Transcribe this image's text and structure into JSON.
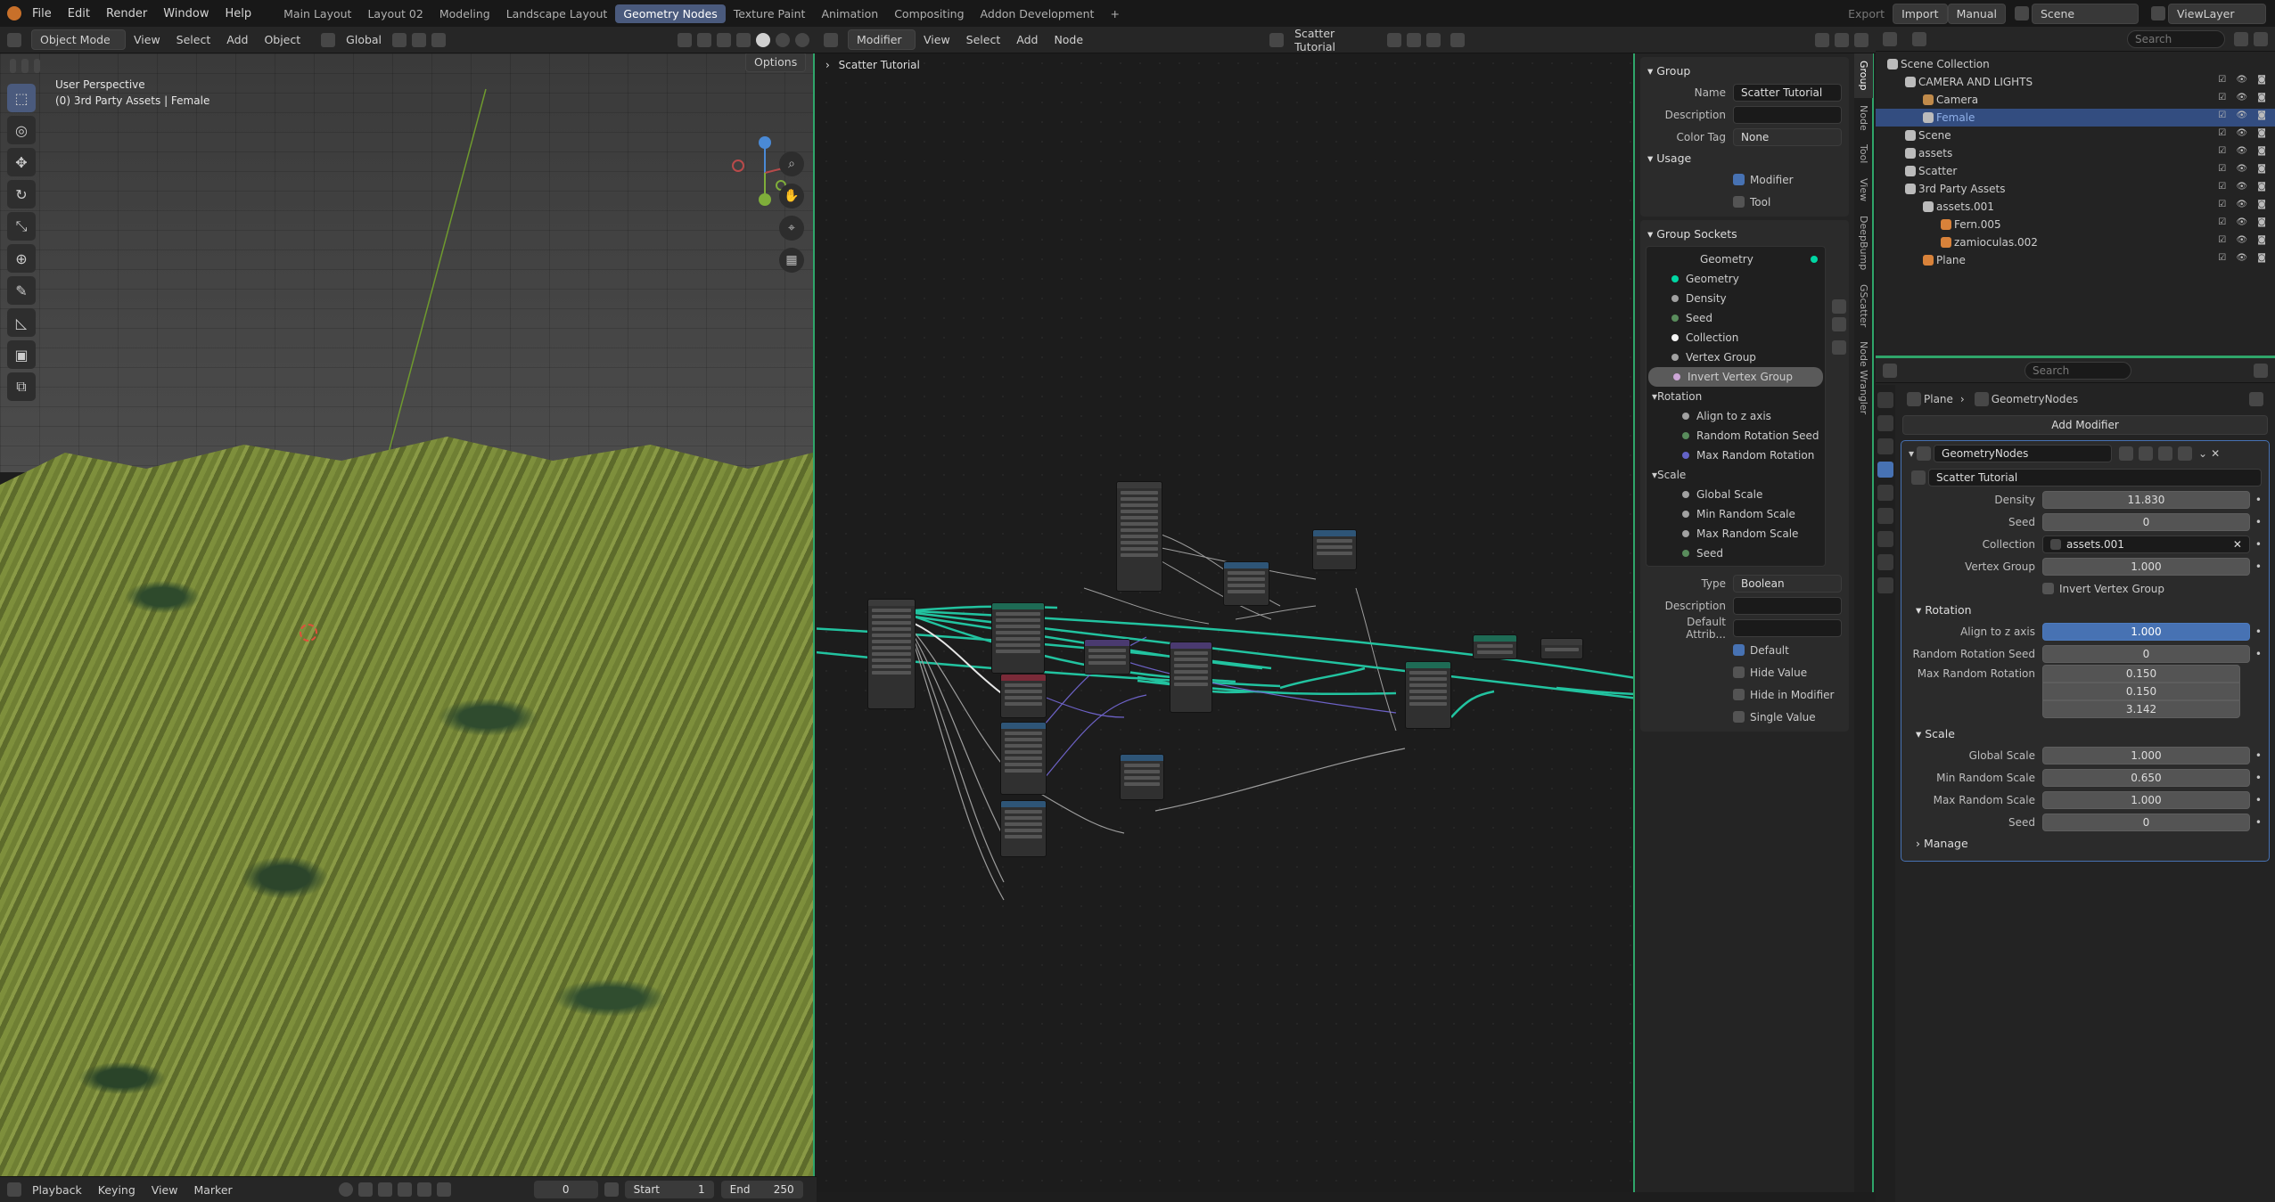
{
  "menubar": {
    "items": [
      "File",
      "Edit",
      "Render",
      "Window",
      "Help"
    ],
    "workspaces": [
      "Main Layout",
      "Layout 02",
      "Modeling",
      "Landscape Layout",
      "Geometry Nodes",
      "Texture Paint",
      "Animation",
      "Compositing",
      "Addon Development"
    ],
    "active_workspace": "Geometry Nodes",
    "add_tab": "+",
    "export_label": "Export",
    "import_label": "Import",
    "manual_label": "Manual",
    "scene": "Scene",
    "view_layer": "ViewLayer"
  },
  "viewport": {
    "mode": "Object Mode",
    "menu": [
      "View",
      "Select",
      "Add",
      "Object"
    ],
    "orientation": "Global",
    "options": "Options",
    "info_line1": "User Perspective",
    "info_line2": "(0) 3rd Party Assets | Female",
    "gizmo_z": "Z",
    "gizmo_y": "Y"
  },
  "node_editor": {
    "mode": "Modifier",
    "menu": [
      "View",
      "Select",
      "Add",
      "Node"
    ],
    "tree_name": "Scatter Tutorial",
    "breadcrumb": "Scatter Tutorial"
  },
  "n_panel": {
    "group_header": "Group",
    "name_label": "Name",
    "name_value": "Scatter Tutorial",
    "description_label": "Description",
    "description_value": "",
    "color_tag_label": "Color Tag",
    "color_tag_value": "None",
    "usage_header": "Usage",
    "usage_modifier": "Modifier",
    "usage_tool": "Tool",
    "sockets_header": "Group Sockets",
    "sockets": [
      {
        "name": "Geometry",
        "color": "#00d6a3"
      },
      {
        "name": "Geometry",
        "color": "#00d6a3"
      },
      {
        "name": "Density",
        "color": "#a1a1a1"
      },
      {
        "name": "Seed",
        "color": "#598c5c"
      },
      {
        "name": "Collection",
        "color": "#f5f5f5"
      },
      {
        "name": "Vertex Group",
        "color": "#a1a1a1"
      },
      {
        "name": "Invert Vertex Group",
        "color": "#cca6d6"
      }
    ],
    "rotation_panel": "Rotation",
    "rotation_sockets": [
      {
        "name": "Align to z axis",
        "color": "#a1a1a1"
      },
      {
        "name": "Random Rotation Seed",
        "color": "#598c5c"
      },
      {
        "name": "Max Random Rotation",
        "color": "#6363c7"
      }
    ],
    "scale_panel": "Scale",
    "scale_sockets": [
      {
        "name": "Global Scale",
        "color": "#a1a1a1"
      },
      {
        "name": "Min Random Scale",
        "color": "#a1a1a1"
      },
      {
        "name": "Max Random Scale",
        "color": "#a1a1a1"
      },
      {
        "name": "Seed",
        "color": "#598c5c"
      }
    ],
    "type_label": "Type",
    "type_value": "Boolean",
    "desc2_label": "Description",
    "default_attr_label": "Default Attrib...",
    "opt_default": "Default",
    "opt_hide_value": "Hide Value",
    "opt_hide_modifier": "Hide in Modifier",
    "opt_single_value": "Single Value"
  },
  "vertical_tabs": [
    "Group",
    "Node",
    "Tool",
    "View",
    "DeepBump",
    "GScatter",
    "Node Wrangler"
  ],
  "outliner": {
    "search_placeholder": "Search",
    "rows": [
      {
        "label": "Scene Collection",
        "indent": 0
      },
      {
        "label": "CAMERA AND LIGHTS",
        "indent": 1
      },
      {
        "label": "Camera",
        "indent": 2
      },
      {
        "label": "Female",
        "indent": 2,
        "selected": true
      },
      {
        "label": "Scene",
        "indent": 1
      },
      {
        "label": "assets",
        "indent": 1
      },
      {
        "label": "Scatter",
        "indent": 1
      },
      {
        "label": "3rd Party Assets",
        "indent": 1
      },
      {
        "label": "assets.001",
        "indent": 2
      },
      {
        "label": "Fern.005",
        "indent": 3
      },
      {
        "label": "zamioculas.002",
        "indent": 3
      },
      {
        "label": "Plane",
        "indent": 2
      }
    ]
  },
  "properties": {
    "search_placeholder": "Search",
    "breadcrumb_object": "Plane",
    "breadcrumb_modifier": "GeometryNodes",
    "add_modifier": "Add Modifier",
    "modifier_name": "GeometryNodes",
    "node_group": "Scatter Tutorial",
    "density_label": "Density",
    "density_value": "11.830",
    "seed_label": "Seed",
    "seed_value": "0",
    "collection_label": "Collection",
    "collection_value": "assets.001",
    "vertex_group_label": "Vertex Group",
    "vertex_group_value": "1.000",
    "invert_label": "Invert Vertex Group",
    "rotation_header": "Rotation",
    "align_label": "Align to z axis",
    "align_value": "1.000",
    "rot_seed_label": "Random Rotation Seed",
    "rot_seed_value": "0",
    "max_rot_label": "Max Random Rotation",
    "max_rot_values": [
      "0.150",
      "0.150",
      "3.142"
    ],
    "scale_header": "Scale",
    "global_scale_label": "Global Scale",
    "global_scale_value": "1.000",
    "min_scale_label": "Min Random Scale",
    "min_scale_value": "0.650",
    "max_scale_label": "Max Random Scale",
    "max_scale_value": "1.000",
    "scale_seed_label": "Seed",
    "scale_seed_value": "0",
    "manage_header": "Manage"
  },
  "timeline": {
    "menu": [
      "Playback",
      "Keying",
      "View",
      "Marker"
    ],
    "current_frame": "0",
    "start_label": "Start",
    "start_value": "1",
    "end_label": "End",
    "end_value": "250"
  },
  "colors": {
    "accent": "#4772b3",
    "selection_border": "#2fa56a",
    "workspace_active": "#4a5a7d",
    "link_geometry": "#22c3a0",
    "link_float": "#9d9d9d"
  }
}
